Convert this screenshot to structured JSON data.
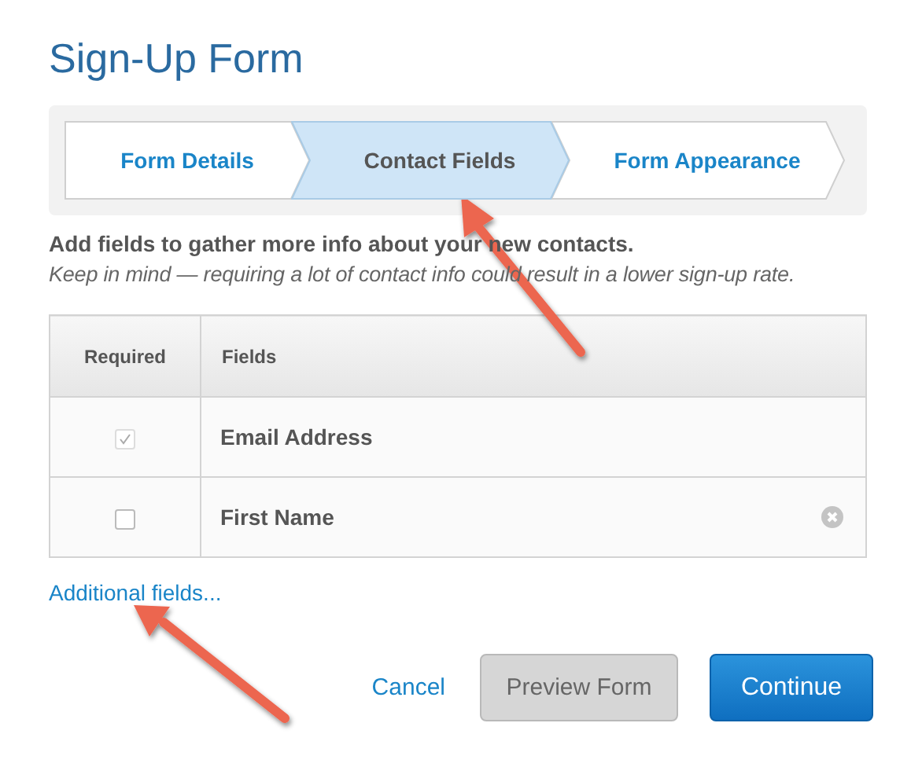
{
  "title": "Sign-Up Form",
  "steps": [
    {
      "label": "Form Details",
      "selected": false
    },
    {
      "label": "Contact Fields",
      "selected": true
    },
    {
      "label": "Form Appearance",
      "selected": false
    }
  ],
  "intro": "Add fields to gather more info about your new contacts.",
  "note": "Keep in mind — requiring a lot of contact info could result in a lower sign-up rate.",
  "table": {
    "columns": [
      "Required",
      "Fields"
    ],
    "rows": [
      {
        "field": "Email Address",
        "checked": true,
        "disabled": true,
        "removable": false
      },
      {
        "field": "First Name",
        "checked": false,
        "disabled": false,
        "removable": true
      }
    ]
  },
  "more_link": "Additional fields...",
  "buttons": [
    {
      "kind": "link",
      "label": "Cancel"
    },
    {
      "kind": "secondary",
      "label": "Preview Form"
    },
    {
      "kind": "primary",
      "label": "Continue"
    }
  ]
}
